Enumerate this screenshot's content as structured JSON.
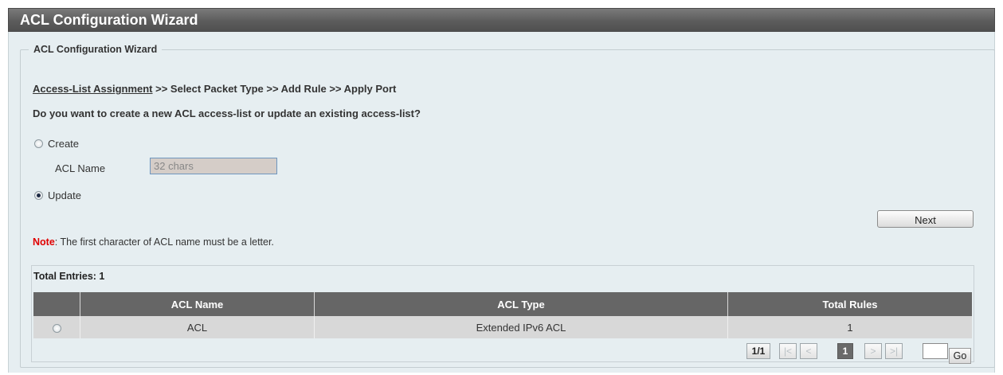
{
  "window_title": "ACL Configuration Wizard",
  "section_title": "ACL Configuration Wizard",
  "steps": {
    "current": "Access-List Assignment",
    "rest": " >> Select Packet Type >> Add Rule >> Apply Port"
  },
  "question": "Do you want to create a new ACL access-list or update an existing access-list?",
  "options": {
    "create_label": "Create",
    "update_label": "Update",
    "selected": "Update"
  },
  "acl_name_field": {
    "label": "ACL Name",
    "placeholder": "32 chars",
    "value": ""
  },
  "next_button": "Next",
  "note": {
    "prefix": "Note",
    "text": ":  The first character of ACL name must be a letter."
  },
  "table": {
    "total_entries": "Total Entries: 1",
    "columns": [
      "",
      "ACL Name",
      "ACL Type",
      "Total Rules"
    ],
    "rows": [
      {
        "acl_name": "ACL",
        "acl_type": "Extended IPv6 ACL",
        "total_rules": "1"
      }
    ]
  },
  "pagination": {
    "page_count": "1/1",
    "first": "|<",
    "prev": "<",
    "current_page": "1",
    "next": ">",
    "last": ">|",
    "go_label": "Go"
  }
}
